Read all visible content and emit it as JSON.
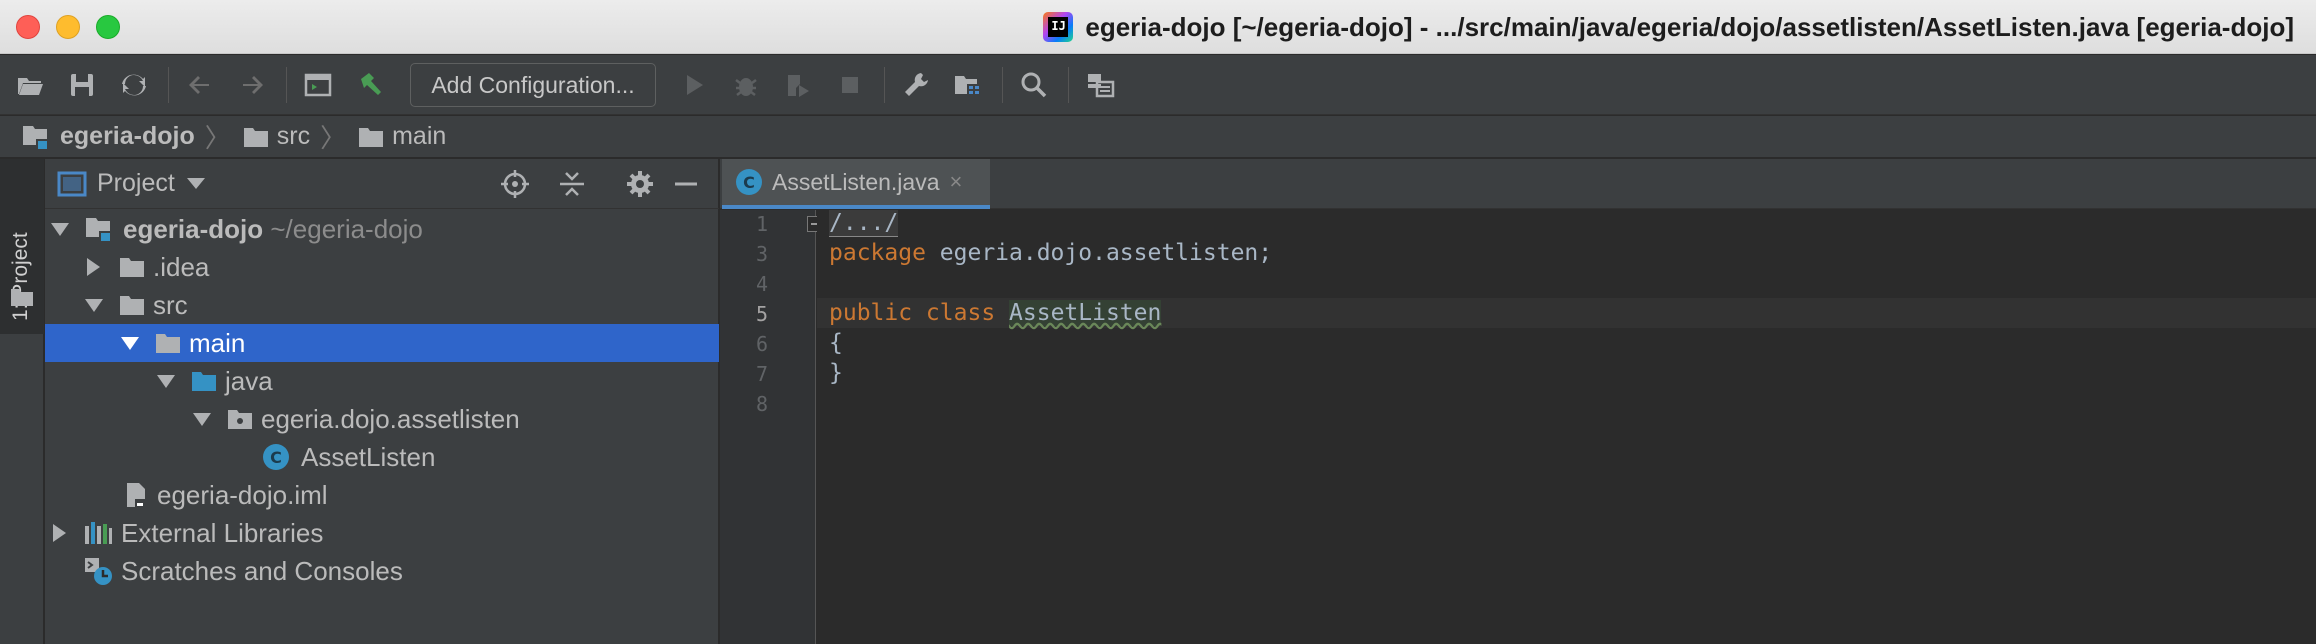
{
  "window": {
    "title": "egeria-dojo [~/egeria-dojo] - .../src/main/java/egeria/dojo/assetlisten/AssetListen.java [egeria-dojo]",
    "app_icon_text": "IJ"
  },
  "toolbar": {
    "run_config_label": "Add Configuration...",
    "icons": [
      "open-icon",
      "save-icon",
      "sync-icon",
      "back-icon",
      "forward-icon",
      "run-window-icon",
      "build-hammer-icon",
      "run-icon",
      "debug-icon",
      "coverage-icon",
      "stop-icon",
      "settings-wrench-icon",
      "project-structure-icon",
      "search-icon",
      "sdk-icon"
    ]
  },
  "breadcrumb": {
    "items": [
      {
        "label": "egeria-dojo",
        "icon": "module-icon"
      },
      {
        "label": "src",
        "icon": "folder-icon"
      },
      {
        "label": "main",
        "icon": "folder-icon"
      }
    ]
  },
  "left_strip": {
    "tab_label": "1: Project"
  },
  "project_panel": {
    "title": "Project",
    "tree": [
      {
        "label": "egeria-dojo",
        "suffix": "~/egeria-dojo",
        "bold": true,
        "expanded": true
      },
      {
        "label": ".idea"
      },
      {
        "label": "src"
      },
      {
        "label": "main",
        "selected": true
      },
      {
        "label": "java"
      },
      {
        "label": "egeria.dojo.assetlisten"
      },
      {
        "label": "AssetListen"
      },
      {
        "label": "egeria-dojo.iml"
      },
      {
        "label": "External Libraries"
      },
      {
        "label": "Scratches and Consoles"
      }
    ]
  },
  "editor": {
    "tab": {
      "label": "AssetListen.java",
      "close": "×",
      "icon_letter": "C"
    },
    "line_numbers": [
      "1",
      "3",
      "4",
      "5",
      "6",
      "7",
      "8"
    ],
    "active_line": "5",
    "code": {
      "line1_fold": "/.../",
      "line3_kw": "package",
      "line3_rest": " egeria.dojo.assetlisten;",
      "line5_kw": "public class",
      "line5_name": "AssetListen",
      "line6": "{",
      "line7": "}"
    }
  },
  "colors": {
    "selection": "#2f65ca",
    "keyword": "#cc7832",
    "panel_bg": "#3c3f41",
    "editor_bg": "#2b2b2b"
  }
}
